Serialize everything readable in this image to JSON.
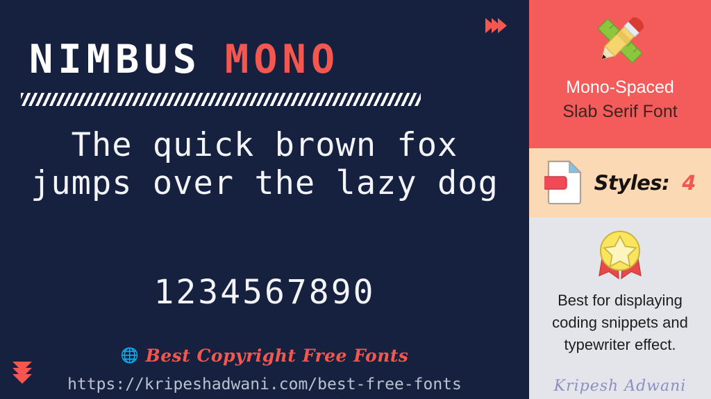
{
  "theme": {
    "background": "#16203f",
    "accent_red": "#f4574f",
    "panel_red": "#f45b5b",
    "panel_peach": "#fbd9b4",
    "panel_gray": "#e4e5ea",
    "text_light": "#f2f4f8",
    "url_gray": "#b9c2cf",
    "signature_color": "#8b8fc4"
  },
  "title": {
    "word_one": "NIMBUS",
    "word_two": "MONO"
  },
  "specimen": {
    "pangram": "The quick brown fox jumps over the lazy dog",
    "numerals": "1234567890"
  },
  "footer": {
    "globe_icon": "globe-icon",
    "promo_text": "Best Copyright Free Fonts",
    "url": "https://kripeshadwani.com/best-free-fonts"
  },
  "decor": {
    "top_chevrons_icon": "chevron-right-icon",
    "top_chevrons_count": 3,
    "bottom_chevrons_icon": "chevron-down-icon",
    "bottom_chevrons_count": 3,
    "hatched_rule": "diagonal-hatch-divider"
  },
  "sidebar": {
    "panels": [
      {
        "id": "category",
        "icon": "pencil-ruler-icon",
        "line_one": "Mono-Spaced",
        "line_two": "Slab Serif Font"
      },
      {
        "id": "styles",
        "icon": "file-tag-icon",
        "label": "Styles:",
        "value": "4"
      },
      {
        "id": "usage",
        "icon": "award-medal-icon",
        "description": "Best for displaying coding snippets and typewriter effect.",
        "signature": "Kripesh Adwani"
      }
    ]
  }
}
